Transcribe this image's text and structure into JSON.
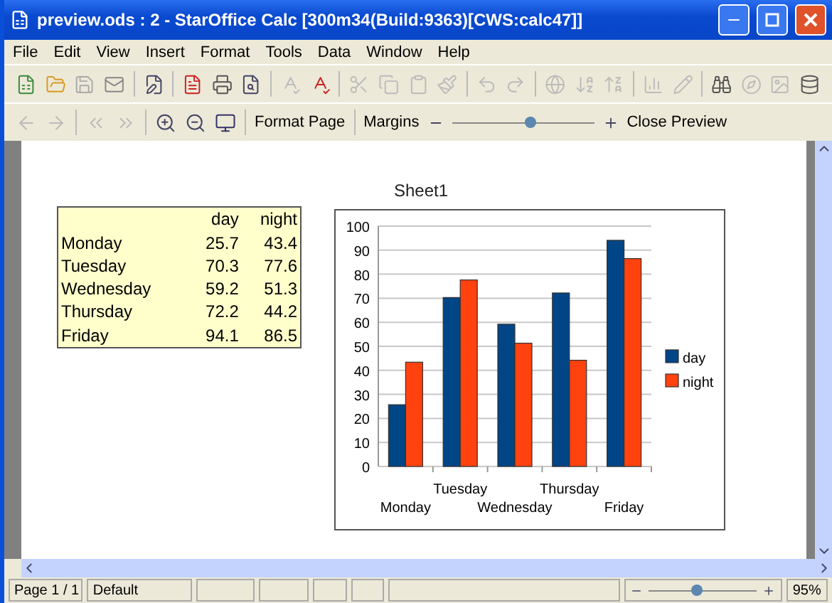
{
  "window": {
    "title": "preview.ods : 2 - StarOffice Calc [300m34(Build:9363)[CWS:calc47]]"
  },
  "menu": [
    "File",
    "Edit",
    "View",
    "Insert",
    "Format",
    "Tools",
    "Data",
    "Window",
    "Help"
  ],
  "preview_toolbar": {
    "format_page": "Format Page",
    "margins": "Margins",
    "zoom": {
      "level": 0.55
    },
    "close": "Close Preview"
  },
  "page": {
    "sheet_title": "Sheet1",
    "table": {
      "columns": [
        "",
        "day",
        "night"
      ],
      "rows": [
        [
          "Monday",
          "25.7",
          "43.4"
        ],
        [
          "Tuesday",
          "70.3",
          "77.6"
        ],
        [
          "Wednesday",
          "59.2",
          "51.3"
        ],
        [
          "Thursday",
          "72.2",
          "44.2"
        ],
        [
          "Friday",
          "94.1",
          "86.5"
        ]
      ]
    },
    "chart_data": {
      "type": "bar",
      "categories": [
        "Monday",
        "Tuesday",
        "Wednesday",
        "Thursday",
        "Friday"
      ],
      "series": [
        {
          "name": "day",
          "color": "#004586",
          "values": [
            25.7,
            70.3,
            59.2,
            72.2,
            94.1
          ]
        },
        {
          "name": "night",
          "color": "#ff420e",
          "values": [
            43.4,
            77.6,
            51.3,
            44.2,
            86.5
          ]
        }
      ],
      "grid": true,
      "legend": true,
      "ylim": [
        0,
        100
      ],
      "yticks": [
        0,
        10,
        20,
        30,
        40,
        50,
        60,
        70,
        80,
        90,
        100
      ]
    }
  },
  "status_bar": {
    "page": "Page 1 / 1",
    "style": "Default",
    "zoom": {
      "level": 0.45
    },
    "zoom_value": "95%"
  }
}
